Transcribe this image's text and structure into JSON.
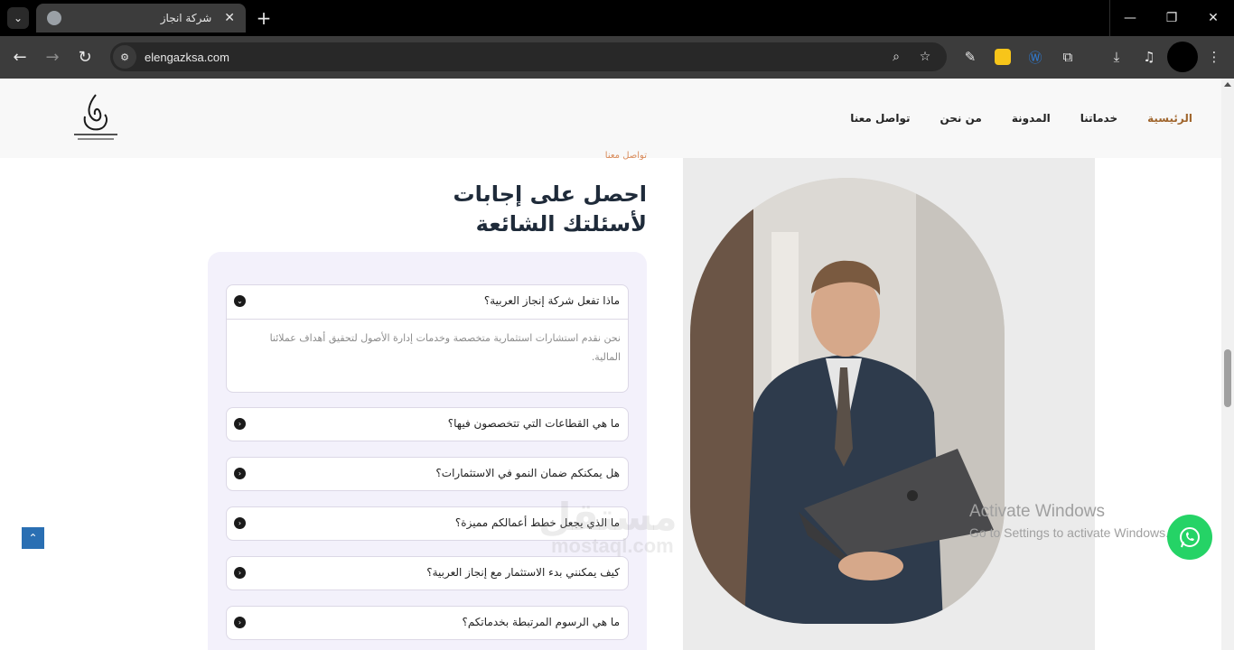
{
  "browser": {
    "tab_title": "شركة انجاز",
    "tab_close": "✕",
    "new_tab": "+",
    "url": "elengazksa.com",
    "window": {
      "minimize": "—",
      "maximize": "❐",
      "close": "✕"
    }
  },
  "header": {
    "nav": [
      {
        "label": "الرئيسية",
        "active": true
      },
      {
        "label": "خدماتنا"
      },
      {
        "label": "المدونة"
      },
      {
        "label": "من نحن"
      },
      {
        "label": "تواصل معنا"
      }
    ],
    "accent_color": "#a0662e"
  },
  "section": {
    "cut_label": "تواصل معنا",
    "title_line1": "احصل على إجابات",
    "title_line2": "لأسئلتك الشائعة"
  },
  "faq": [
    {
      "question": "ماذا تفعل شركة إنجاز العربية؟",
      "answer": "نحن نقدم استشارات استثمارية متخصصة وخدمات إدارة الأصول لتحقيق أهداف عملائنا المالية.",
      "open": true
    },
    {
      "question": "ما هي القطاعات التي تتخصصون فيها؟"
    },
    {
      "question": "هل يمكنكم ضمان النمو في الاستثمارات؟"
    },
    {
      "question": "ما الذي يجعل خطط أعمالكم مميزة؟"
    },
    {
      "question": "كيف يمكنني بدء الاستثمار مع إنجاز العربية؟"
    },
    {
      "question": "ما هي الرسوم المرتبطة بخدماتكم؟"
    }
  ],
  "overlay": {
    "activate_line1": "Activate Windows",
    "activate_line2": "Go to Settings to activate Windows.",
    "watermark": "مستقل",
    "watermark_url": "mostaql.com"
  }
}
